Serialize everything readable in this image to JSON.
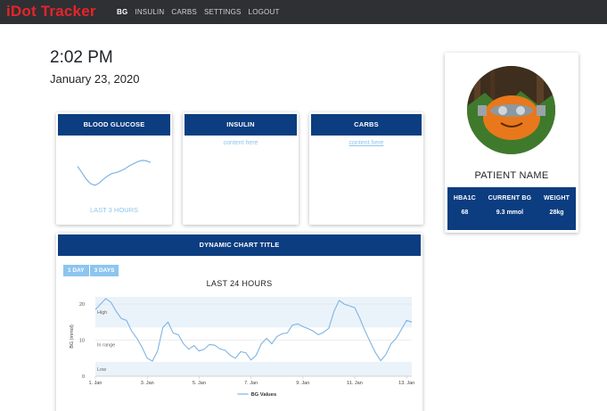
{
  "nav": {
    "brand": "iDot Tracker",
    "links": [
      "BG",
      "INSULIN",
      "CARBS",
      "SETTINGS",
      "LOGOUT"
    ]
  },
  "header": {
    "time": "2:02 PM",
    "date": "January 23, 2020"
  },
  "cards": {
    "bg": {
      "title": "BLOOD GLUCOSE",
      "footer": "LAST 3 HOURS"
    },
    "insulin": {
      "title": "INSULIN",
      "content": "content here"
    },
    "carbs": {
      "title": "CARBS",
      "content": "content here"
    }
  },
  "patient": {
    "name": "PATIENT NAME",
    "stats": [
      {
        "label": "HBA1C",
        "value": "68"
      },
      {
        "label": "CURRENT BG",
        "value": "9.3 mmol"
      },
      {
        "label": "WEIGHT",
        "value": "28kg"
      }
    ]
  },
  "chart_panel": {
    "title": "DYNAMIC CHART TITLE",
    "buttons": [
      "1 DAY",
      "3 DAYS"
    ]
  },
  "colors": {
    "navy": "#0b3d80",
    "accent": "#8dc5ee",
    "brand": "#e8232b",
    "line": "#7fb4e3"
  },
  "chart_data": [
    {
      "type": "line",
      "title": "",
      "x": [
        0,
        1,
        2,
        3,
        4,
        5,
        6,
        7,
        8,
        9,
        10,
        11,
        12,
        13,
        14,
        15,
        16,
        17
      ],
      "series": [
        {
          "values": [
            12.5,
            11.0,
            9.5,
            8.4,
            8.0,
            8.5,
            9.4,
            10.2,
            10.8,
            11.0,
            11.4,
            11.9,
            12.6,
            13.1,
            13.6,
            13.9,
            13.8,
            13.4
          ]
        }
      ],
      "ylim": [
        5,
        16
      ]
    },
    {
      "type": "line",
      "title": "LAST 24 HOURS",
      "xlabel": "",
      "ylabel": "BG (mmol)",
      "xlim": [
        1,
        13.2
      ],
      "ylim": [
        0,
        22
      ],
      "xticks": [
        {
          "v": 1,
          "label": "1. Jan"
        },
        {
          "v": 3,
          "label": "3. Jan"
        },
        {
          "v": 5,
          "label": "5. Jan"
        },
        {
          "v": 7,
          "label": "7. Jan"
        },
        {
          "v": 9,
          "label": "9. Jan"
        },
        {
          "v": 11,
          "label": "11. Jan"
        },
        {
          "v": 13,
          "label": "13. Jan"
        }
      ],
      "yticks": [
        0,
        10,
        20
      ],
      "bands": [
        {
          "label": "High",
          "from": 13.5,
          "to": 22
        },
        {
          "label": "In range",
          "from": 4,
          "to": 13.5
        },
        {
          "label": "Low",
          "from": 0,
          "to": 4
        }
      ],
      "x": [
        1.0,
        1.2,
        1.4,
        1.6,
        1.8,
        2.0,
        2.2,
        2.4,
        2.6,
        2.8,
        3.0,
        3.2,
        3.4,
        3.6,
        3.8,
        4.0,
        4.2,
        4.4,
        4.6,
        4.8,
        5.0,
        5.2,
        5.4,
        5.6,
        5.8,
        6.0,
        6.2,
        6.4,
        6.6,
        6.8,
        7.0,
        7.2,
        7.4,
        7.6,
        7.8,
        8.0,
        8.2,
        8.4,
        8.6,
        8.8,
        9.0,
        9.2,
        9.4,
        9.6,
        9.8,
        10.0,
        10.2,
        10.4,
        10.6,
        10.8,
        11.0,
        11.2,
        11.4,
        11.6,
        11.8,
        12.0,
        12.2,
        12.4,
        12.6,
        12.8,
        13.0,
        13.2
      ],
      "series": [
        {
          "name": "BG Values",
          "values": [
            18.5,
            20.0,
            21.5,
            20.5,
            18.0,
            16.0,
            15.5,
            12.5,
            10.5,
            8.0,
            5.0,
            4.2,
            7.0,
            13.5,
            15.0,
            12.0,
            11.5,
            9.0,
            7.5,
            8.5,
            7.0,
            7.5,
            8.8,
            8.6,
            7.6,
            7.2,
            5.8,
            5.0,
            6.8,
            6.5,
            4.5,
            5.8,
            9.0,
            10.5,
            9.0,
            11.0,
            11.8,
            12.0,
            14.2,
            14.5,
            13.8,
            13.2,
            12.5,
            11.5,
            12.2,
            13.3,
            18.0,
            21.0,
            20.0,
            19.5,
            19.0,
            16.0,
            12.5,
            9.5,
            6.5,
            4.3,
            6.0,
            9.0,
            10.5,
            13.0,
            15.5,
            15.0
          ]
        }
      ]
    }
  ]
}
